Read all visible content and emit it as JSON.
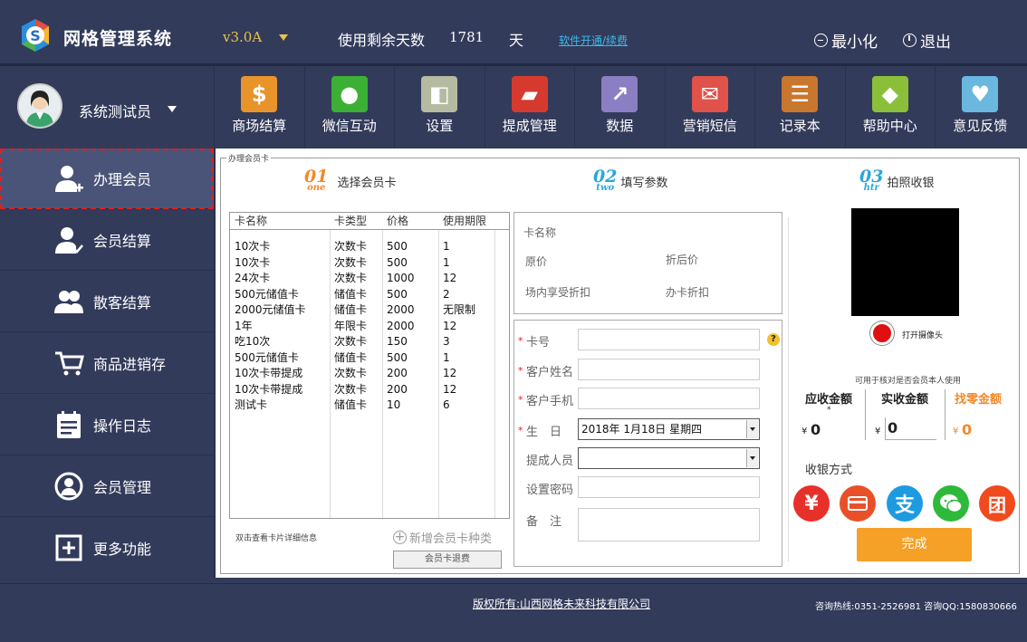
{
  "header": {
    "app_title": "网格管理系统",
    "version": "v3.0A",
    "days_label": "使用剩余天数",
    "days_value": "1781",
    "days_unit": "天",
    "renew_link": "软件开通/续费",
    "minimize_label": "最小化",
    "exit_label": "退出"
  },
  "user": {
    "name": "系统测试员"
  },
  "toolbar": [
    {
      "label": "商场结算",
      "icon": "dollar-icon",
      "color": "#e8942a"
    },
    {
      "label": "微信互动",
      "icon": "wechat-icon",
      "color": "#3cb034"
    },
    {
      "label": "设置",
      "icon": "toggle-settings-icon",
      "color": "#b5bba0"
    },
    {
      "label": "提成管理",
      "icon": "briefcase-icon",
      "color": "#d63a2f"
    },
    {
      "label": "数据",
      "icon": "chart-icon",
      "color": "#8a7fc2"
    },
    {
      "label": "营销短信",
      "icon": "envelope-icon",
      "color": "#e0524a"
    },
    {
      "label": "记录本",
      "icon": "notebook-icon",
      "color": "#c9772e"
    },
    {
      "label": "帮助中心",
      "icon": "help-cube-icon",
      "color": "#8bbf3a"
    },
    {
      "label": "意见反馈",
      "icon": "feedback-bubble-icon",
      "color": "#6ab7e0"
    }
  ],
  "sidebar": [
    {
      "label": "办理会员",
      "icon": "add-user-icon",
      "active": true
    },
    {
      "label": "会员结算",
      "icon": "user-check-icon",
      "active": false
    },
    {
      "label": "散客结算",
      "icon": "users-icon",
      "active": false
    },
    {
      "label": "商品进销存",
      "icon": "cart-icon",
      "active": false
    },
    {
      "label": "操作日志",
      "icon": "calendar-log-icon",
      "active": false
    },
    {
      "label": "会员管理",
      "icon": "user-circle-icon",
      "active": false
    },
    {
      "label": "更多功能",
      "icon": "plus-square-icon",
      "active": false
    }
  ],
  "panel": {
    "title": "办理会员卡",
    "sec1": {
      "num": "01",
      "sub": "one",
      "title": "选择会员卡"
    },
    "sec2": {
      "num": "02",
      "sub": "two",
      "title": "填写参数"
    },
    "sec3": {
      "num": "03",
      "sub": "htr",
      "title": "拍照收银"
    },
    "table": {
      "headers": [
        "卡名称",
        "卡类型",
        "价格",
        "使用期限"
      ],
      "rows": [
        [
          "10次卡",
          "次数卡",
          "500",
          "1"
        ],
        [
          "10次卡",
          "次数卡",
          "500",
          "1"
        ],
        [
          "24次卡",
          "次数卡",
          "1000",
          "12"
        ],
        [
          "500元储值卡",
          "储值卡",
          "500",
          "2"
        ],
        [
          "2000元储值卡",
          "储值卡",
          "2000",
          "无限制"
        ],
        [
          "1年",
          "年限卡",
          "2000",
          "12"
        ],
        [
          "吃10次",
          "次数卡",
          "150",
          "3"
        ],
        [
          "500元储值卡",
          "储值卡",
          "500",
          "1"
        ],
        [
          "10次卡带提成",
          "次数卡",
          "200",
          "12"
        ],
        [
          "10次卡带提成",
          "次数卡",
          "200",
          "12"
        ],
        [
          "测试卡",
          "储值卡",
          "10",
          "6"
        ]
      ]
    },
    "hint": "双击查看卡片详细信息",
    "add_type": "新增会员卡种类",
    "refund": "会员卡退费",
    "params": {
      "card_name": "卡名称",
      "original_price": "原价",
      "discount_price": "折后价",
      "venue_discount": "场内享受折扣",
      "card_discount": "办卡折扣"
    },
    "form": {
      "card_no": "卡号",
      "customer_name": "客户姓名",
      "customer_phone": "客户手机",
      "birthday": "生　日",
      "birthday_value": "2018年  1月18日 星期四",
      "commission_staff": "提成人员",
      "password": "设置密码",
      "remarks": "备　注"
    },
    "cashier": {
      "open_camera": "打开摄像头",
      "verify_note": "可用于核对是否会员本人使用",
      "receivable_label": "应收金额",
      "paid_label": "实收金额",
      "change_label": "找零金额",
      "currency": "¥",
      "receivable": "0",
      "paid": "0",
      "change": "0",
      "pay_method_label": "收银方式",
      "done": "完成"
    }
  },
  "footer": {
    "copyright": "版权所有:山西网格未来科技有限公司",
    "hotline": "咨询热线:0351-2526981  咨询QQ:1580830666"
  }
}
